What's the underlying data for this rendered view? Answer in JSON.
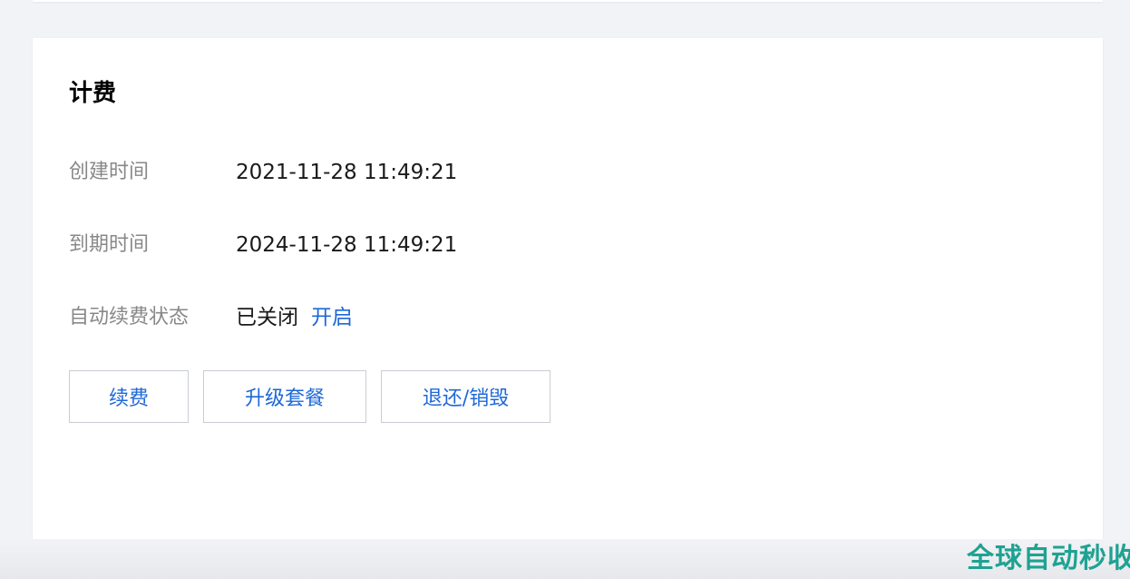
{
  "billing": {
    "title": "计费",
    "created": {
      "label": "创建时间",
      "value": "2021-11-28 11:49:21"
    },
    "expiry": {
      "label": "到期时间",
      "value": "2024-11-28 11:49:21"
    },
    "auto_renew": {
      "label": "自动续费状态",
      "status": "已关闭",
      "action": "开启"
    },
    "buttons": {
      "renew": "续费",
      "upgrade": "升级套餐",
      "refund": "退还/销毁"
    }
  },
  "watermark": {
    "text": "全球自动秒收"
  },
  "colors": {
    "link": "#1e68d8",
    "watermark": "#1fa292",
    "background": "#f2f3f6"
  }
}
